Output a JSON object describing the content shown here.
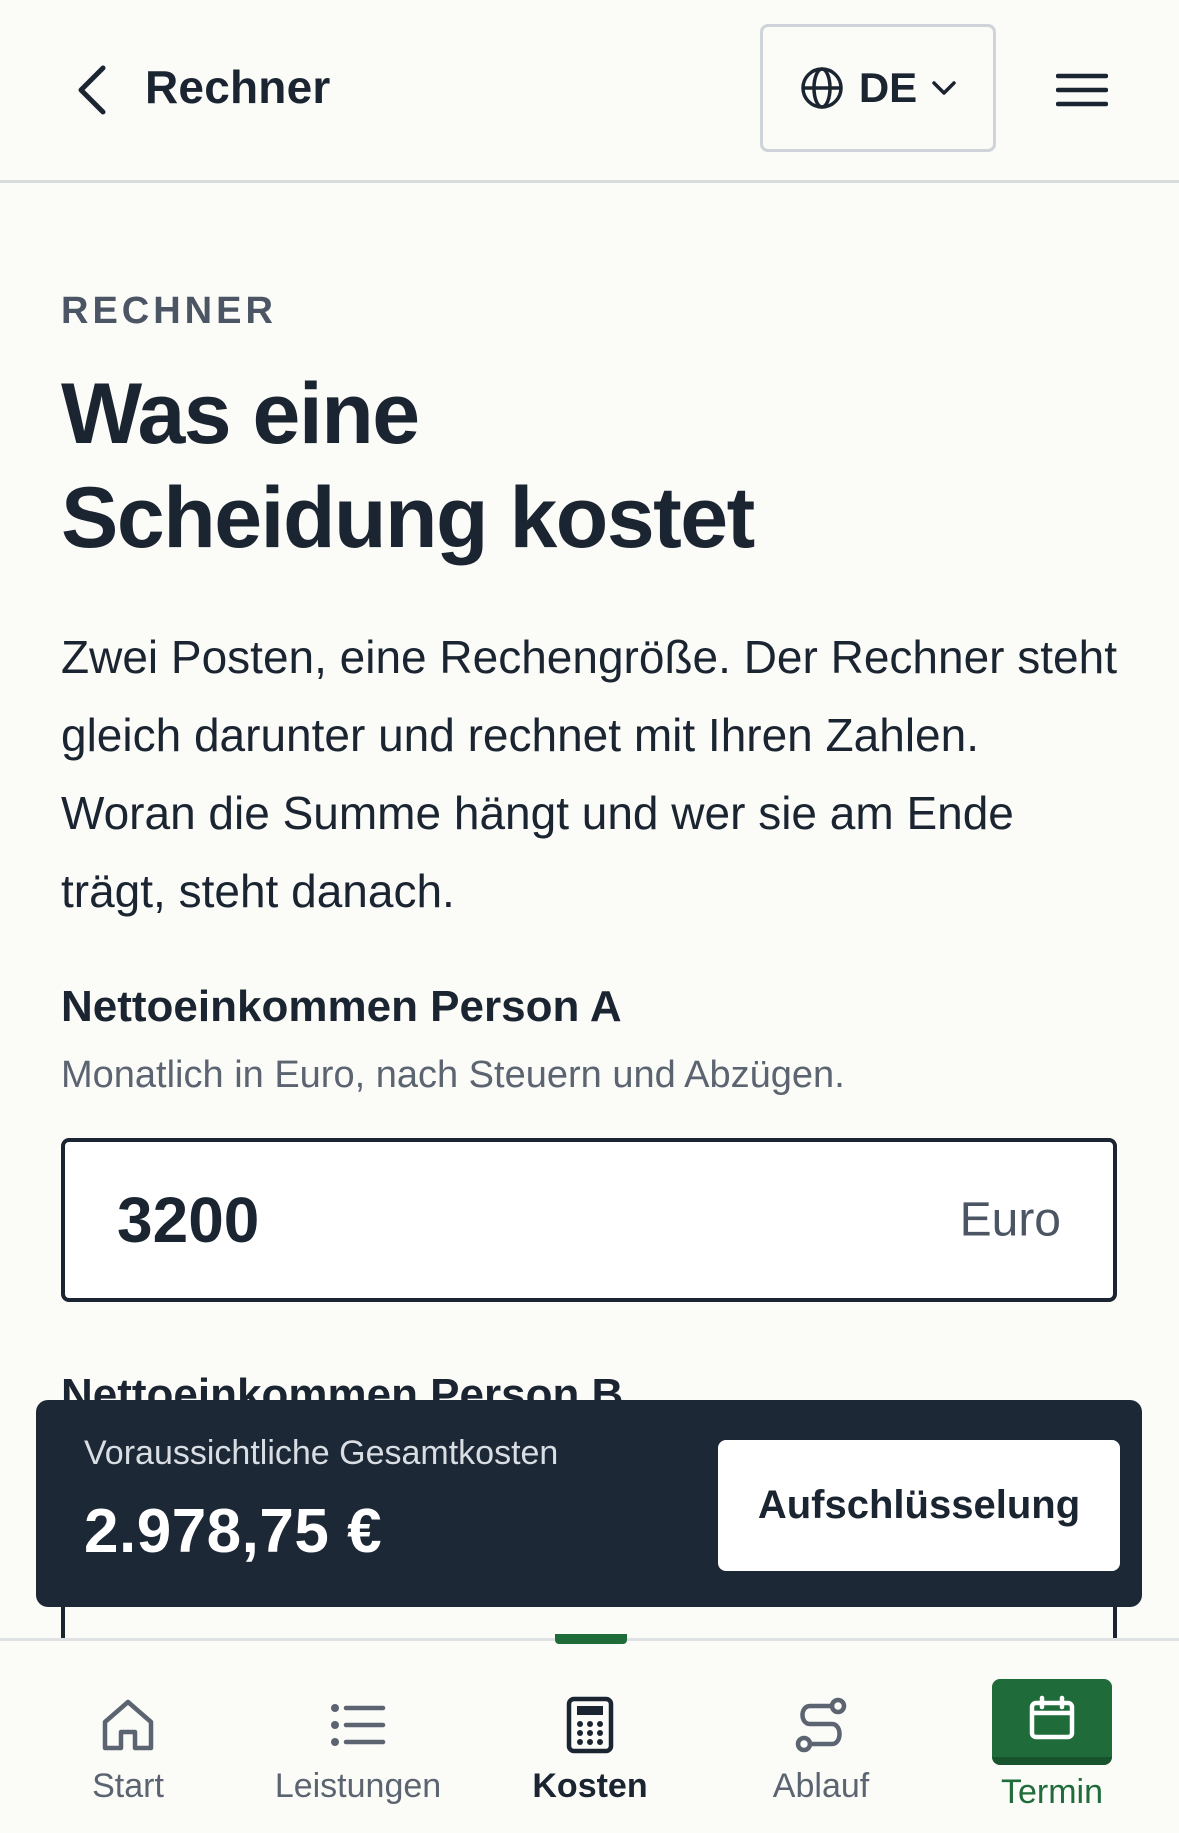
{
  "topbar": {
    "title": "Rechner",
    "language": "DE"
  },
  "hero": {
    "eyebrow": "RECHNER",
    "title_line1": "Was eine",
    "title_line2": "Scheidung kostet",
    "intro": "Zwei Posten, eine Rechengröße. Der Rechner steht gleich darunter und rechnet mit Ihren Zahlen. Woran die Summe hängt und wer sie am Ende trägt, steht danach."
  },
  "form": {
    "person_a": {
      "label": "Nettoeinkommen Person A",
      "help": "Monatlich in Euro, nach Steuern und Abzügen.",
      "value": "3200",
      "unit": "Euro"
    },
    "person_b": {
      "label": "Nettoeinkommen Person B"
    }
  },
  "total": {
    "label": "Voraussichtliche Gesamtkosten",
    "value": "2.978,75 €",
    "button": "Aufschlüsselung"
  },
  "nav": {
    "items": [
      {
        "label": "Start",
        "icon": "home-icon"
      },
      {
        "label": "Leistungen",
        "icon": "list-icon"
      },
      {
        "label": "Kosten",
        "icon": "calculator-icon",
        "active": true
      },
      {
        "label": "Ablauf",
        "icon": "route-icon"
      },
      {
        "label": "Termin",
        "icon": "calendar-icon",
        "cta": true
      }
    ]
  },
  "colors": {
    "ink": "#1b2431",
    "accent_green": "#1f6b3a",
    "total_bar": "#1d2836"
  }
}
